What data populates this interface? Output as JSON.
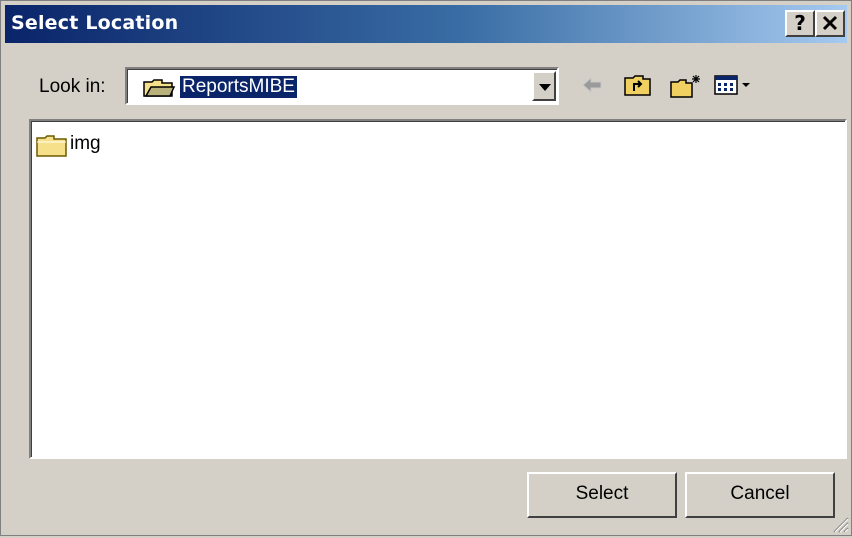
{
  "window": {
    "title": "Select Location"
  },
  "titlebar_buttons": {
    "help": "?",
    "close": "✕"
  },
  "lookin": {
    "label": "Look in:",
    "value": "ReportsMIBE"
  },
  "toolbar": {
    "icons": [
      "back-arrow-icon",
      "up-one-level-icon",
      "create-new-folder-icon",
      "view-menu-icon"
    ]
  },
  "files": [
    {
      "name": "img",
      "icon": "folder-icon"
    }
  ],
  "buttons": {
    "select": "Select",
    "cancel": "Cancel"
  }
}
